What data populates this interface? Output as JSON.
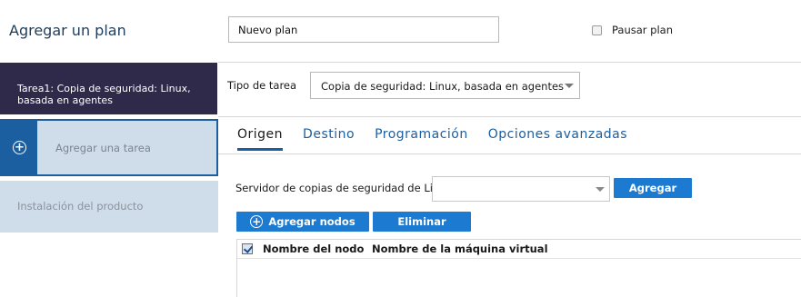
{
  "header": {
    "title": "Agregar un plan",
    "plan_name_value": "Nuevo plan",
    "pause_label": "Pausar plan",
    "pause_checked": false
  },
  "sidebar": {
    "active_task_label": "Tarea1: Copia de seguridad: Linux, basada en agentes",
    "add_task_label": "Agregar una tarea",
    "install_label": "Instalación del producto"
  },
  "task_type": {
    "label": "Tipo de tarea",
    "selected": "Copia de seguridad: Linux, basada en agentes"
  },
  "tabs": [
    {
      "label": "Origen",
      "active": true
    },
    {
      "label": "Destino",
      "active": false
    },
    {
      "label": "Programación",
      "active": false
    },
    {
      "label": "Opciones avanzadas",
      "active": false
    }
  ],
  "source": {
    "server_label": "Servidor de copias de seguridad de Linux",
    "server_value": "",
    "add_button": "Agregar",
    "add_nodes_button": "Agregar nodos",
    "delete_button": "Eliminar"
  },
  "table": {
    "columns": [
      "Nombre del nodo",
      "Nombre de la máquina virtual"
    ],
    "header_checked": true,
    "rows": []
  },
  "colors": {
    "accent": "#1c7bd0",
    "sidebar_active": "#2f2a4a",
    "sidebar_inactive": "#cfdcea",
    "tab_link": "#1c5fa0"
  }
}
